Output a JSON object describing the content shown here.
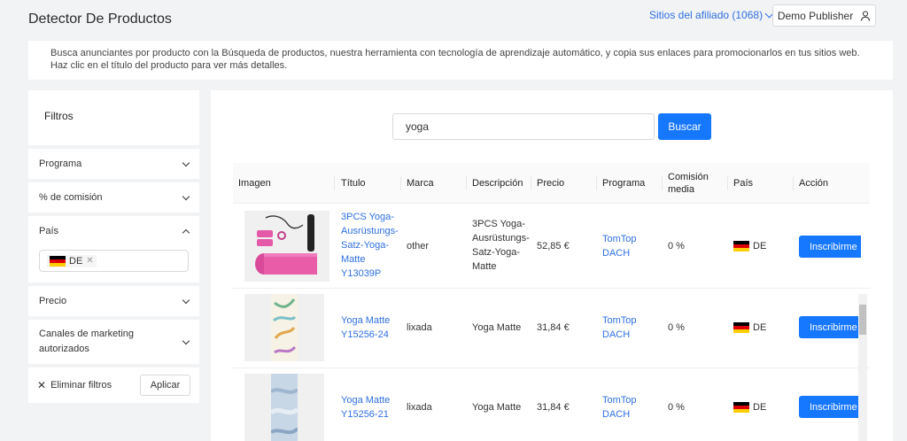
{
  "header": {
    "title": "Detector De Productos",
    "sites_link": "Sitios del afiliado (1068)",
    "publisher": "Demo Publisher"
  },
  "intro": "Busca anunciantes por producto con la Búsqueda de productos, nuestra herramienta con tecnología de aprendizaje automático, y copia sus enlaces para promocionarlos en tus sitios web. Haz clic en el título del producto para ver más detalles.",
  "sidebar": {
    "title": "Filtros",
    "filters": [
      "Programa",
      "% de comisión",
      "País",
      "Precio",
      "Canales de marketing autorizados"
    ],
    "country_tag": "DE",
    "clear_label": "Eliminar filtros",
    "apply_label": "Aplicar"
  },
  "search": {
    "value": "yoga",
    "button": "Buscar"
  },
  "table": {
    "headers": [
      "Imagen",
      "Título",
      "Marca",
      "Descripción",
      "Precio",
      "Programa",
      "Comisión media",
      "País",
      "Acción"
    ],
    "rows": [
      {
        "title": "3PCS Yoga-Ausrüstungs-Satz-Yoga-Matte Y13039P",
        "brand": "other",
        "description": "3PCS Yoga-Ausrüstungs-Satz-Yoga-Matte",
        "price": "52,85 €",
        "program": "TomTop DACH",
        "commission": "0 %",
        "country": "DE",
        "action": "Inscribirme"
      },
      {
        "title": "Yoga Matte Y15256-24",
        "brand": "lixada",
        "description": "Yoga Matte",
        "price": "31,84 €",
        "program": "TomTop DACH",
        "commission": "0 %",
        "country": "DE",
        "action": "Inscribirme"
      },
      {
        "title": "Yoga Matte Y15256-21",
        "brand": "lixada",
        "description": "Yoga Matte",
        "price": "31,84 €",
        "program": "TomTop DACH",
        "commission": "0 %",
        "country": "DE",
        "action": "Inscribirme"
      }
    ]
  },
  "colors": {
    "primary": "#1677ff",
    "link": "#2f6fe0",
    "background": "#f2f3f5"
  }
}
